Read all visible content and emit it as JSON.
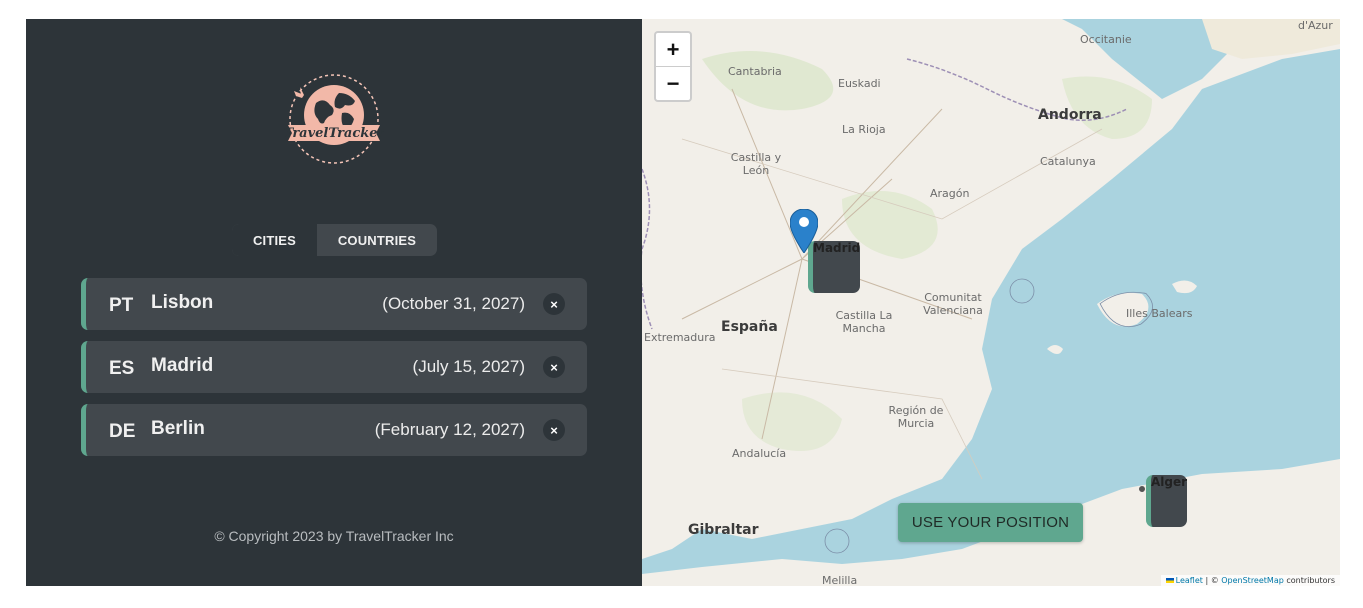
{
  "sidebar": {
    "logo_text": "TravelTracker",
    "tabs": [
      {
        "label": "CITIES",
        "active": true
      },
      {
        "label": "COUNTRIES",
        "active": false
      }
    ],
    "cities": [
      {
        "code": "PT",
        "name": "Lisbon",
        "date": "(October 31, 2027)",
        "delete_label": "×"
      },
      {
        "code": "ES",
        "name": "Madrid",
        "date": "(July 15, 2027)",
        "delete_label": "×"
      },
      {
        "code": "DE",
        "name": "Berlin",
        "date": "(February 12, 2027)",
        "delete_label": "×"
      }
    ],
    "copyright": "© Copyright 2023 by TravelTracker Inc"
  },
  "map": {
    "zoom_in": "+",
    "zoom_out": "−",
    "labels": {
      "andorra": "Andorra",
      "espana": "España",
      "madrid": "Madrid",
      "gibraltar": "Gibraltar",
      "alger": "Alger",
      "catalunya": "Catalunya",
      "aragon": "Aragón",
      "la_rioja": "La Rioja",
      "euskadi": "Euskadi",
      "cantabria": "Cantabria",
      "castilla_leon": "Castilla y León",
      "castilla_mancha": "Castilla La Mancha",
      "comunitat_valenciana": "Comunitat Valenciana",
      "illes_balears": "Illes Balears",
      "region_murcia": "Región de Murcia",
      "andalucia": "Andalucía",
      "extremadura": "Extremadura",
      "occitanie": "Occitanie",
      "melilla": "Melilla",
      "dazur": "d'Azur"
    },
    "use_position_label": "USE YOUR POSITION",
    "attribution": {
      "leaflet": "Leaflet",
      "separator": " | © ",
      "osm": "OpenStreetMap",
      "suffix": " contributors"
    },
    "colors": {
      "sea": "#aad3df",
      "land": "#f2efe9",
      "accent": "#5fa78f",
      "marker": "#2a81cb"
    }
  }
}
